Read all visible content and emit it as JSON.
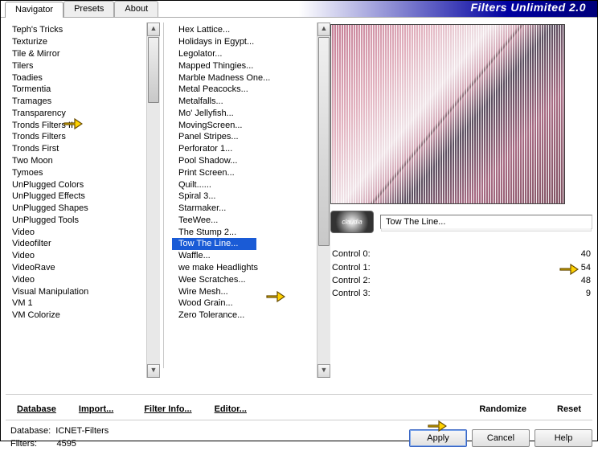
{
  "title": "Filters Unlimited 2.0",
  "tabs": [
    "Navigator",
    "Presets",
    "About"
  ],
  "categories": [
    "Teph's Tricks",
    "Texturize",
    "Tile & Mirror",
    "Tilers",
    "Toadies",
    "Tormentia",
    "Tramages",
    "Transparency",
    "Tronds Filters II",
    "Tronds Filters",
    "Tronds First",
    "Two Moon",
    "Tymoes",
    "UnPlugged Colors",
    "UnPlugged Effects",
    "UnPlugged Shapes",
    "UnPlugged Tools",
    "Video",
    "Videofilter",
    "Video",
    "VideoRave",
    "Video",
    "Visual Manipulation",
    "VM 1",
    "VM Colorize"
  ],
  "filters": [
    "Hex Lattice...",
    "Holidays in Egypt...",
    "Legolator...",
    "Mapped Thingies...",
    "Marble Madness One...",
    "Metal Peacocks...",
    "Metalfalls...",
    "Mo' Jellyfish...",
    "MovingScreen...",
    "Panel Stripes...",
    "Perforator 1...",
    "Pool Shadow...",
    "Print Screen...",
    "Quilt......",
    "Spiral 3...",
    "Starmaker...",
    "TeeWee...",
    "The Stump 2...",
    "Tow The Line...",
    "Waffle...",
    "we make Headlights",
    "Wee Scratches...",
    "Wire Mesh...",
    "Wood Grain...",
    "Zero Tolerance..."
  ],
  "selected_filter": "Tow The Line...",
  "selected_filter_index": 18,
  "eye_label": "claudia",
  "filter_display": "Tow The Line...",
  "controls": [
    {
      "label": "Control 0:",
      "value": "40"
    },
    {
      "label": "Control 1:",
      "value": "54"
    },
    {
      "label": "Control 2:",
      "value": "48"
    },
    {
      "label": "Control 3:",
      "value": "9"
    }
  ],
  "midbar": {
    "database": "Database",
    "import": "Import...",
    "info": "Filter Info...",
    "editor": "Editor...",
    "randomize": "Randomize",
    "reset": "Reset"
  },
  "status": {
    "db_lbl": "Database:",
    "db_val": "ICNET-Filters",
    "fl_lbl": "Filters:",
    "fl_val": "4595"
  },
  "buttons": {
    "apply": "Apply",
    "cancel": "Cancel",
    "help": "Help"
  }
}
